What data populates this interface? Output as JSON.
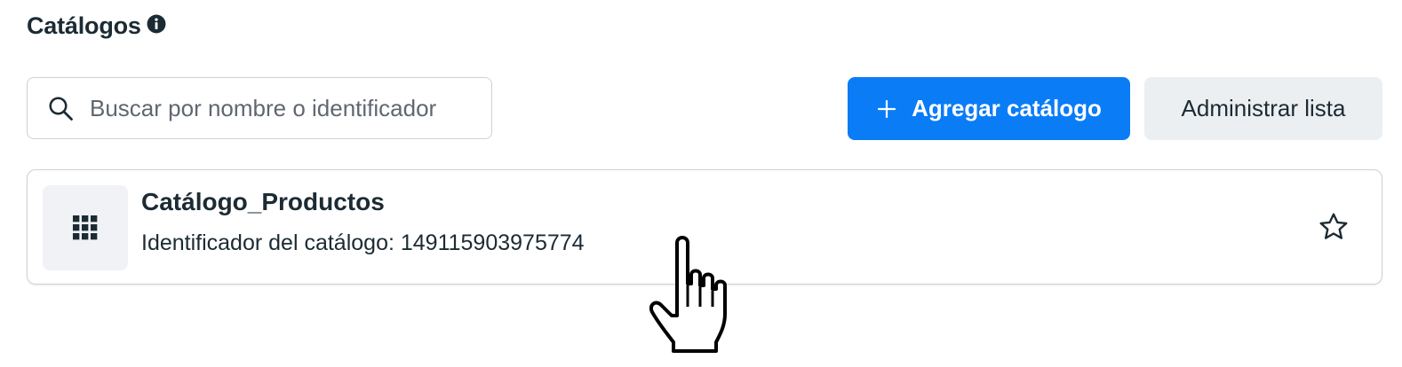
{
  "header": {
    "title": "Catálogos",
    "info_icon": "info-circle-icon"
  },
  "search": {
    "placeholder": "Buscar por nombre o identificador",
    "value": "",
    "icon": "search-icon"
  },
  "toolbar": {
    "add_label": "Agregar catálogo",
    "add_icon": "plus-icon",
    "manage_label": "Administrar lista"
  },
  "catalogs": [
    {
      "name": "Catálogo_Productos",
      "id_text": "Identificador del catálogo: 149115903975774",
      "thumbnail_icon": "grid-icon",
      "favorite_icon": "star-outline-icon"
    }
  ],
  "colors": {
    "primary": "#0a7cf6",
    "secondary_bg": "#eceff2",
    "text": "#1c2b33",
    "border": "#cbd2d9"
  }
}
